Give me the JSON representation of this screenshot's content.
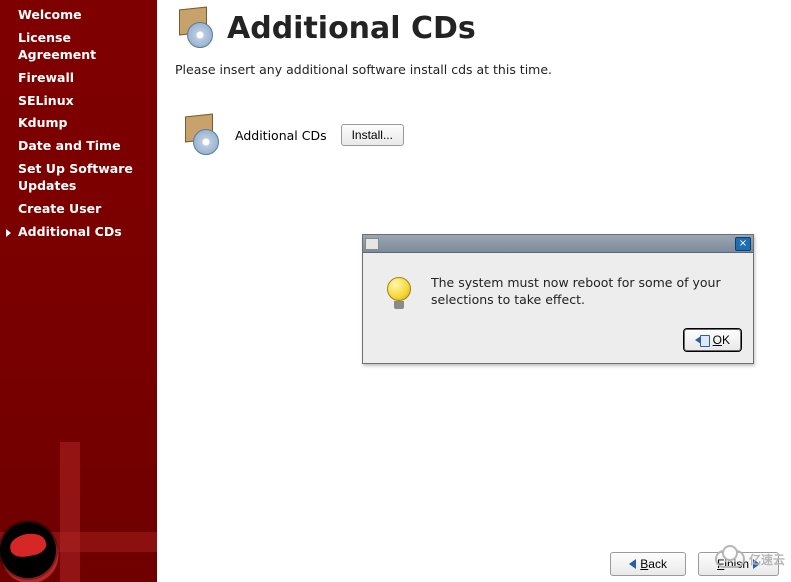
{
  "sidebar": {
    "items": [
      {
        "label": "Welcome"
      },
      {
        "label": "License Agreement"
      },
      {
        "label": "Firewall"
      },
      {
        "label": "SELinux"
      },
      {
        "label": "Kdump"
      },
      {
        "label": "Date and Time"
      },
      {
        "label": "Set Up Software Updates"
      },
      {
        "label": "Create User"
      },
      {
        "label": "Additional CDs"
      }
    ],
    "current_index": 8
  },
  "page": {
    "title": "Additional CDs",
    "description": "Please insert any additional software install cds at this time.",
    "section_label": "Additional CDs",
    "install_button": "Install..."
  },
  "dialog": {
    "message": "The system must now reboot for some of your selections to take effect.",
    "ok_label": "OK",
    "ok_mnemonic": "O",
    "ok_rest": "K"
  },
  "footer": {
    "back_mnemonic": "B",
    "back_rest": "ack",
    "forward_mnemonic": "F",
    "forward_rest": "inish"
  },
  "watermark": "亿速云"
}
